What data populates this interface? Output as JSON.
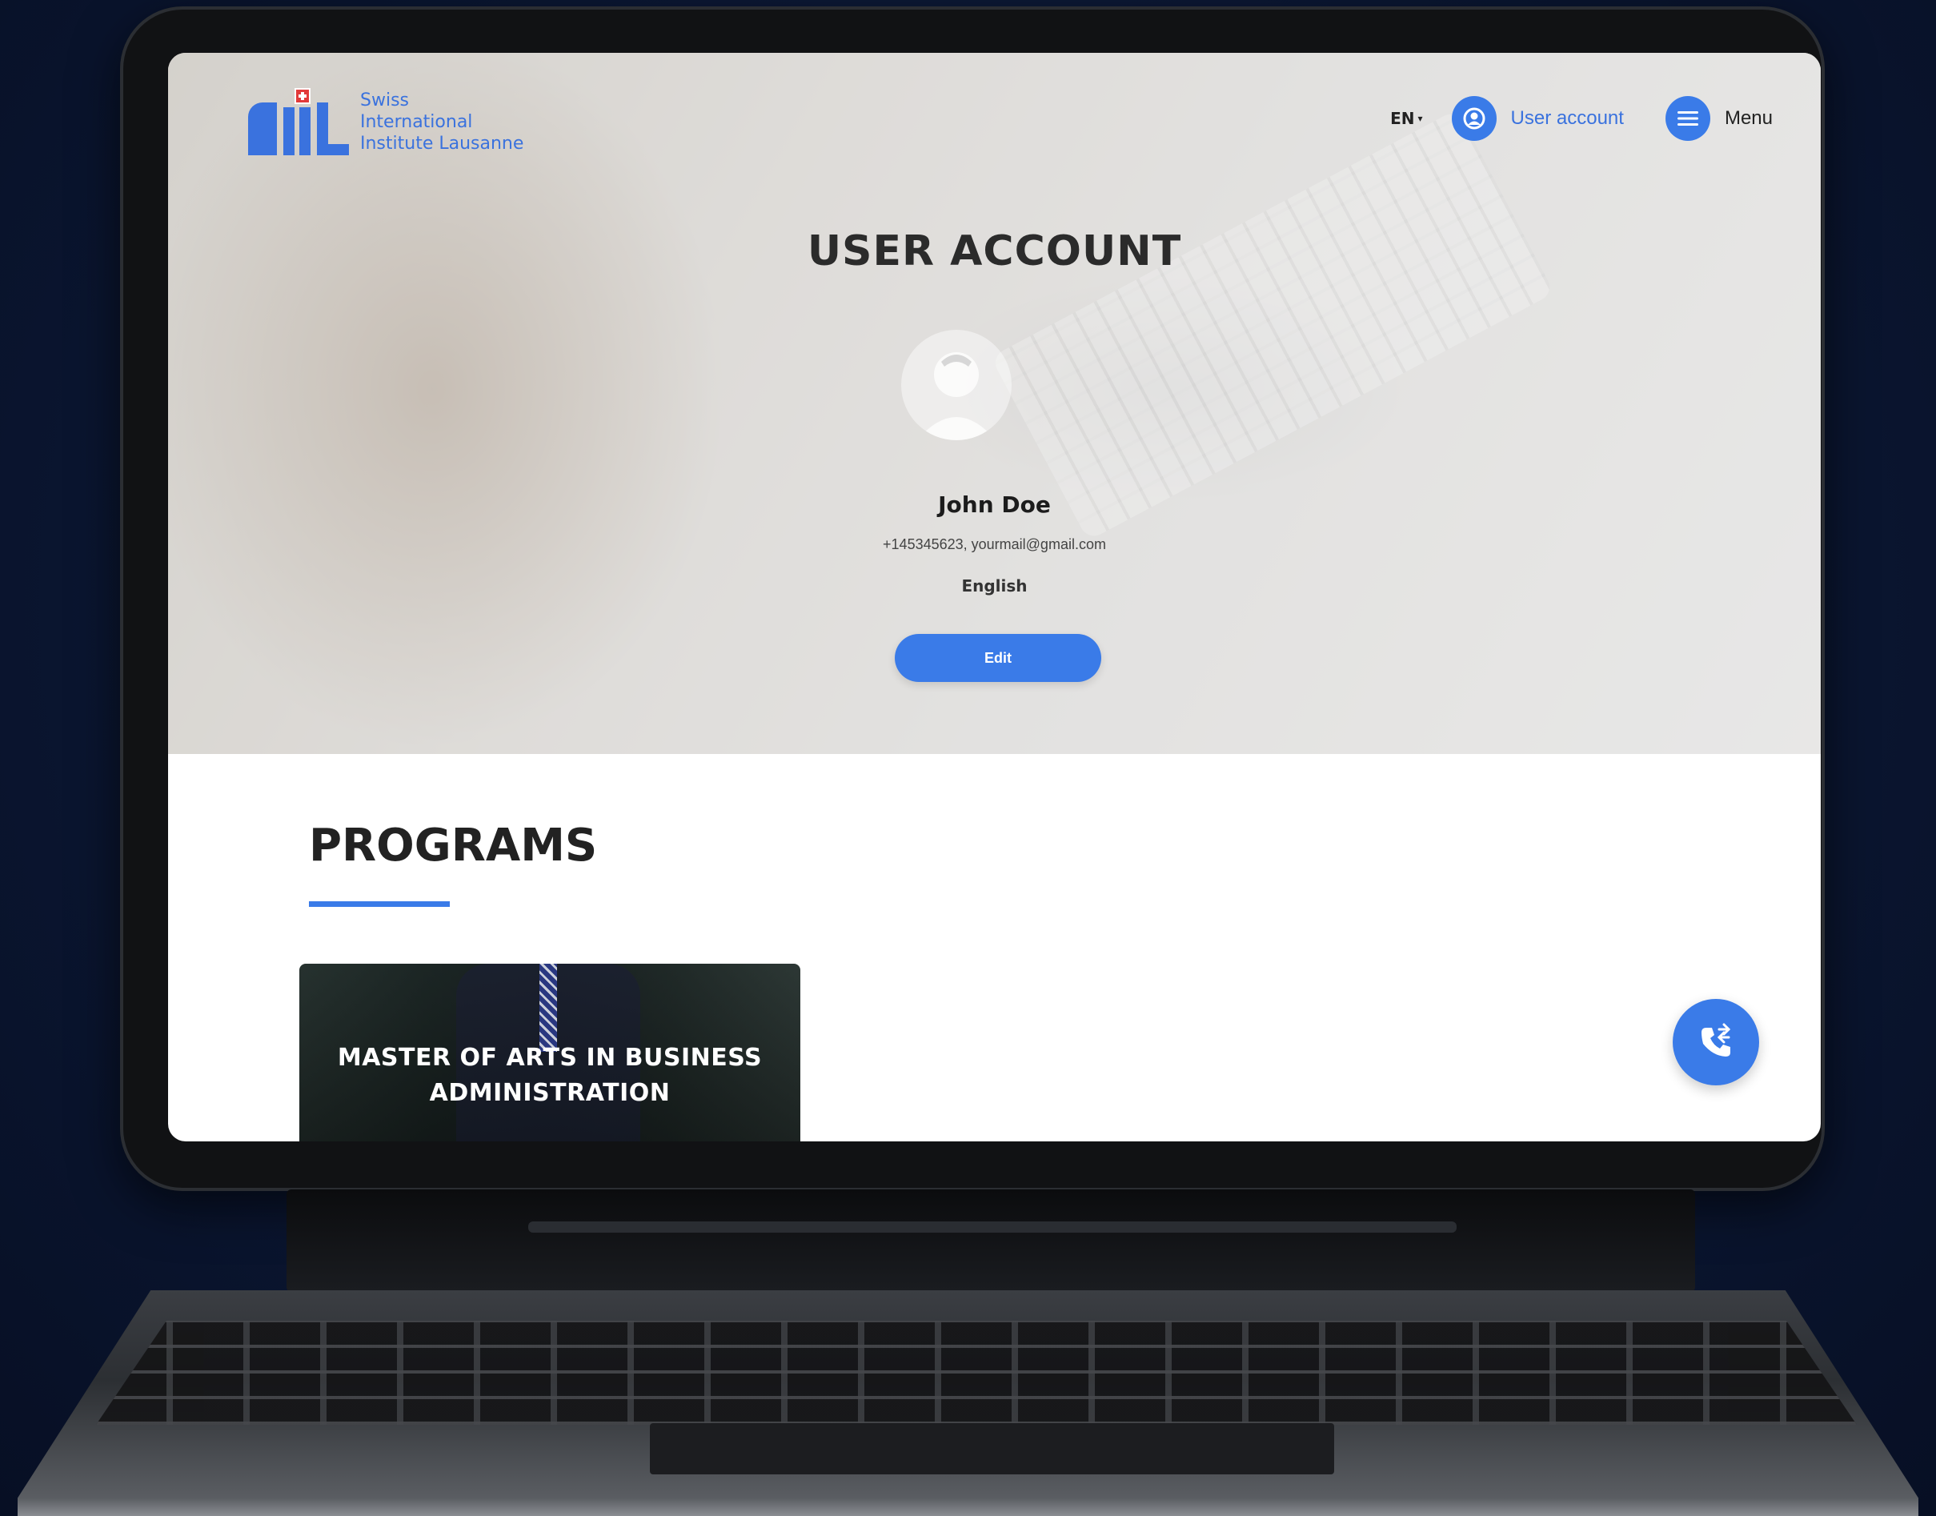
{
  "brand": {
    "lines": [
      "Swiss",
      "International",
      "Institute Lausanne"
    ]
  },
  "nav": {
    "language": "EN",
    "account_label": "User account",
    "menu_label": "Menu"
  },
  "page": {
    "title": "USER ACCOUNT"
  },
  "profile": {
    "name": "John Doe",
    "contact": "+145345623, yourmail@gmail.com",
    "language": "English",
    "edit_label": "Edit"
  },
  "programs": {
    "title": "PROGRAMS",
    "items": [
      {
        "title": "MASTER OF ARTS IN BUSINESS ADMINISTRATION"
      }
    ]
  },
  "colors": {
    "accent": "#3a7be8",
    "brand_blue": "#3a72de",
    "background": "#0b1733"
  },
  "icons": {
    "user": "user-circle-icon",
    "menu": "hamburger-icon",
    "call": "phone-call-icon",
    "caret": "caret-down-icon"
  }
}
